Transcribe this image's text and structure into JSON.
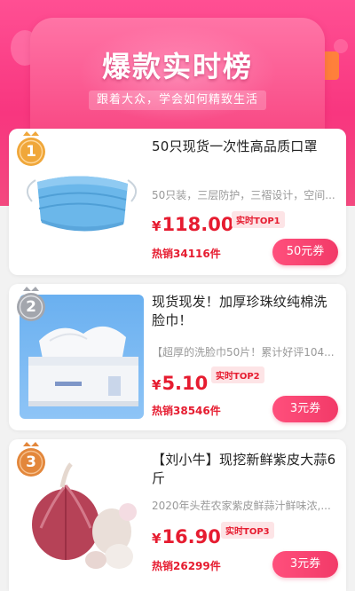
{
  "banner": {
    "title": "爆款实时榜",
    "subtitle": "跟着大众，学会如何精致生活"
  },
  "products": [
    {
      "rank": "1",
      "title": "50只现货一次性高品质口罩",
      "description": "50只装，三层防护，三褶设计，空间...",
      "currency": "¥",
      "price": "118.00",
      "rank_tag": "实时TOP1",
      "sales": "热销34116件",
      "coupon": "50元券",
      "image": "face-mask-image",
      "badge_color": "#f0a73a"
    },
    {
      "rank": "2",
      "title": "现货现发！加厚珍珠纹纯棉洗脸巾！",
      "description": "【超厚的洗脸巾50片！累计好评104...",
      "currency": "¥",
      "price": "5.10",
      "rank_tag": "实时TOP2",
      "sales": "热销38546件",
      "coupon": "3元券",
      "image": "face-towel-pack-image",
      "badge_color": "#a3a6ad"
    },
    {
      "rank": "3",
      "title": "【刘小牛】现挖新鲜紫皮大蒜6斤",
      "description": "2020年头茬农家紫皮鲜蒜汁鲜味浓,...",
      "currency": "¥",
      "price": "16.90",
      "rank_tag": "实时TOP3",
      "sales": "热销26299件",
      "coupon": "3元券",
      "image": "purple-garlic-image",
      "badge_color": "#e3873b"
    }
  ],
  "colors": {
    "accent": "#e61c30",
    "banner_pink": "#f8367f",
    "coupon_gradient_start": "#ff4f7c",
    "coupon_gradient_end": "#f23a68"
  }
}
